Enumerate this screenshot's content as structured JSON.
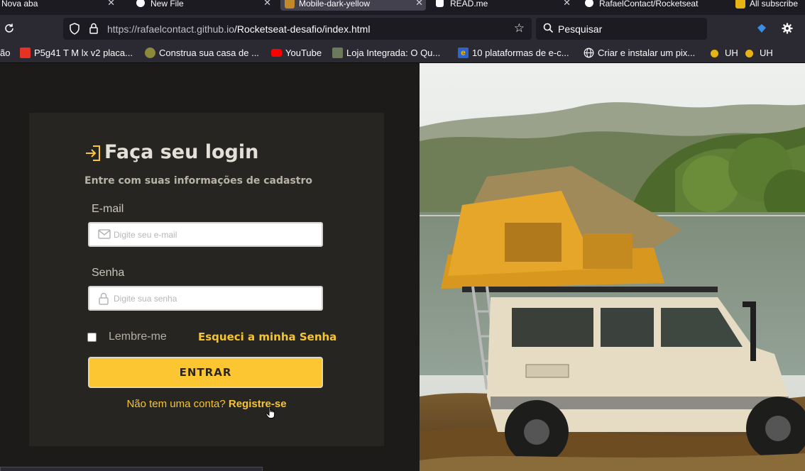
{
  "browser": {
    "tabs": [
      {
        "label": "Nova aba",
        "active": false
      },
      {
        "label": "New File",
        "active": false
      },
      {
        "label": "Mobile-dark-yellow",
        "active": true
      },
      {
        "label": "READ.me",
        "active": false
      },
      {
        "label": "RafaelContact/Rocketseat",
        "active": false
      },
      {
        "label": "All subscribe",
        "active": false
      }
    ],
    "url_host": "https://rafaelcontact.github.io",
    "url_path": "/Rocketseat-desafio/index.html",
    "search_placeholder": "Pesquisar",
    "bookmarks": [
      {
        "label": "ão",
        "icon": "folder-icon"
      },
      {
        "label": "P5g41 T M lx v2 placa...",
        "icon": "aliexpress-icon",
        "color": "#e43225"
      },
      {
        "label": "Construa sua casa de ...",
        "icon": "site-icon",
        "color": "#8a8a3a"
      },
      {
        "label": "YouTube",
        "icon": "youtube-icon",
        "color": "#ff0000"
      },
      {
        "label": "Loja Integrada: O Qu...",
        "icon": "site-icon",
        "color": "#6a7a5a"
      },
      {
        "label": "10 plataformas de e-c...",
        "icon": "e-icon",
        "color": "#2a66d0"
      },
      {
        "label": "Criar e instalar um pix...",
        "icon": "globe-icon"
      },
      {
        "label": "UH",
        "icon": "uh-icon",
        "color": "#e7b416"
      },
      {
        "label": "UH",
        "icon": "uh-icon",
        "color": "#e7b416"
      }
    ]
  },
  "login": {
    "title": "Faça seu login",
    "subtitle": "Entre com suas informações de cadastro",
    "email_label": "E-mail",
    "email_placeholder": "Digite seu e-mail",
    "password_label": "Senha",
    "password_placeholder": "Digite sua senha",
    "remember_label": "Lembre-me",
    "forgot_label": "Esqueci a minha Senha",
    "enter_label": "ENTRAR",
    "no_account": "Não tem uma conta?",
    "register_label": "Registre-se"
  },
  "colors": {
    "accent": "#fcc532",
    "link": "#f7c431",
    "card_bg": "#262522",
    "page_bg": "#1c1b19"
  }
}
